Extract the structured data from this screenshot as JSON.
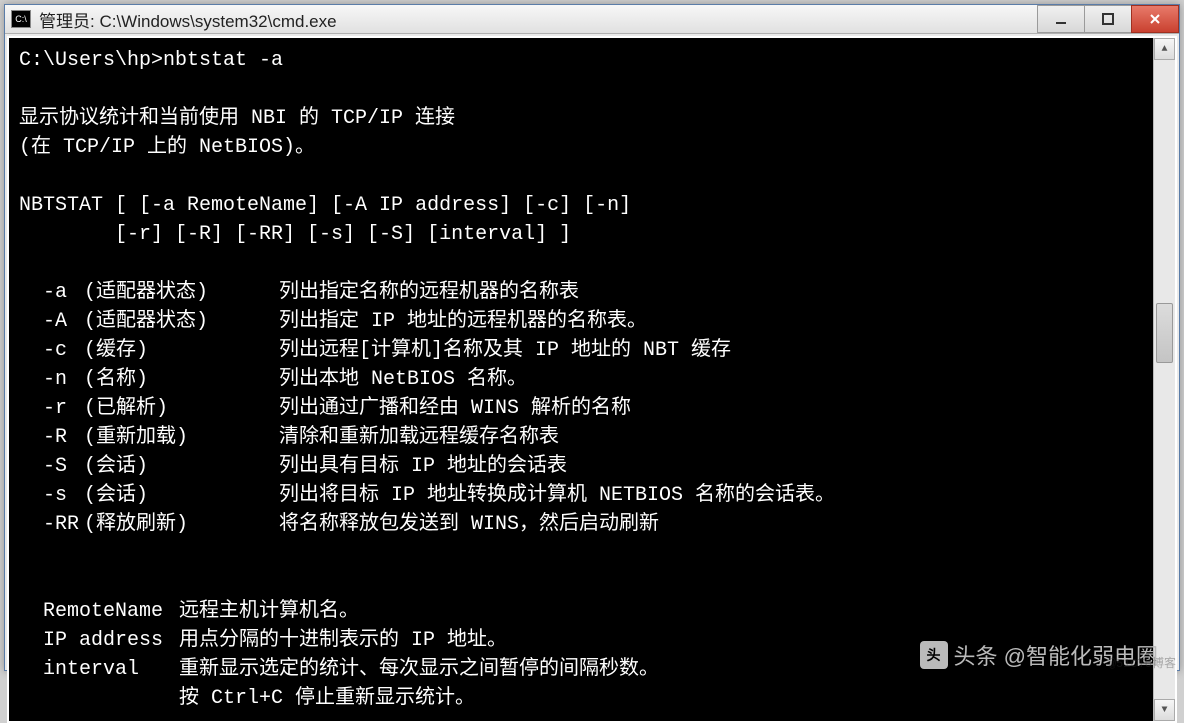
{
  "window": {
    "icon_text": "C:\\",
    "title": "管理员: C:\\Windows\\system32\\cmd.exe"
  },
  "terminal": {
    "prompt": "C:\\Users\\hp>nbtstat -a",
    "desc1": "显示协议统计和当前使用 NBI 的 TCP/IP 连接",
    "desc2": "(在 TCP/IP 上的 NetBIOS)。",
    "usage1": "NBTSTAT [ [-a RemoteName] [-A IP address] [-c] [-n]",
    "usage2": "        [-r] [-R] [-RR] [-s] [-S] [interval] ]",
    "opts": [
      {
        "f": "-a",
        "l": "(适配器状态)",
        "d": "列出指定名称的远程机器的名称表"
      },
      {
        "f": "-A",
        "l": "(适配器状态)",
        "d": "列出指定 IP 地址的远程机器的名称表。"
      },
      {
        "f": "-c",
        "l": "(缓存)",
        "d": "列出远程[计算机]名称及其 IP 地址的 NBT 缓存"
      },
      {
        "f": "-n",
        "l": "(名称)",
        "d": "列出本地 NetBIOS 名称。"
      },
      {
        "f": "-r",
        "l": "(已解析)",
        "d": "列出通过广播和经由 WINS 解析的名称"
      },
      {
        "f": "-R",
        "l": "(重新加载)",
        "d": "清除和重新加载远程缓存名称表"
      },
      {
        "f": "-S",
        "l": "(会话)",
        "d": "列出具有目标 IP 地址的会话表"
      },
      {
        "f": "-s",
        "l": "(会话)",
        "d": "列出将目标 IP 地址转换成计算机 NETBIOS 名称的会话表。"
      },
      {
        "f": "-RR",
        "l": "(释放刷新)",
        "d": "将名称释放包发送到 WINS，然后启动刷新"
      }
    ],
    "params": [
      {
        "k": "RemoteName",
        "d": "远程主机计算机名。"
      },
      {
        "k": "IP address",
        "d": "用点分隔的十进制表示的 IP 地址。"
      },
      {
        "k": "interval",
        "d": "重新显示选定的统计、每次显示之间暂停的间隔秒数。"
      }
    ],
    "tail": "按 Ctrl+C 停止重新显示统计。"
  },
  "watermark": {
    "icon": "头",
    "text": "头条 @智能化弱电圈",
    "faint": "@51CTO博客"
  }
}
